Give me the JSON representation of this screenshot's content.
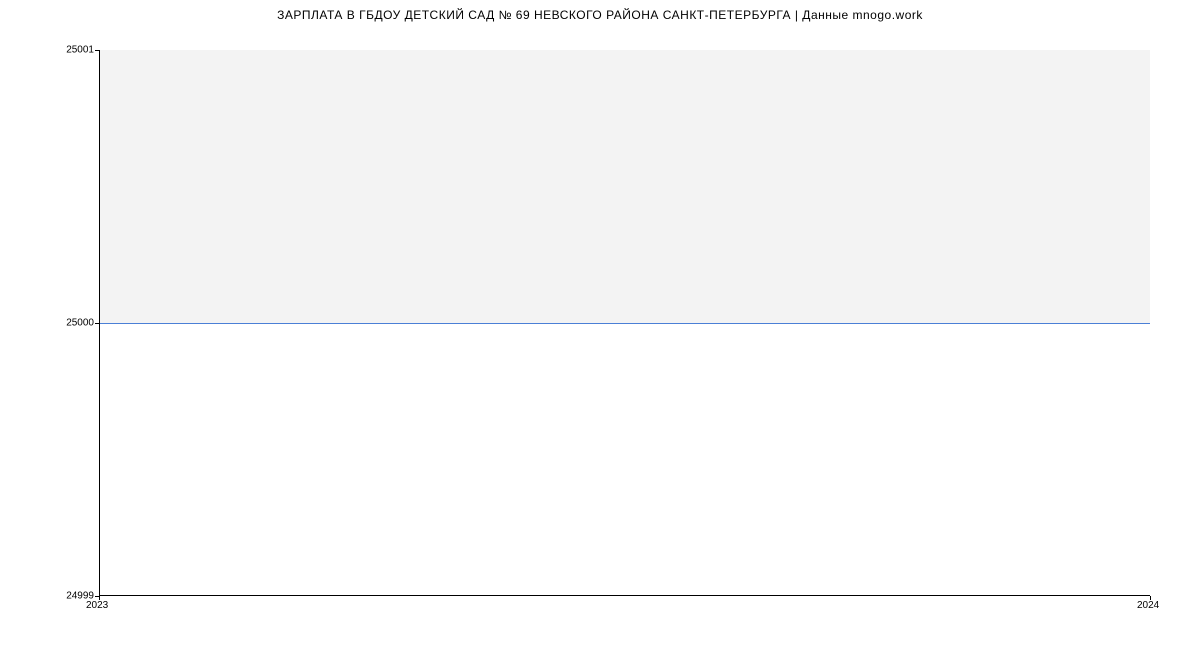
{
  "chart_data": {
    "type": "line",
    "title": "ЗАРПЛАТА В ГБДОУ ДЕТСКИЙ САД № 69 НЕВСКОГО РАЙОНА САНКТ-ПЕТЕРБУРГА | Данные mnogo.work",
    "x": [
      2023,
      2024
    ],
    "values": [
      25000,
      25000
    ],
    "ylim": [
      24999,
      25001
    ],
    "xlim": [
      2023,
      2024
    ],
    "y_ticks": [
      24999,
      25000,
      25001
    ],
    "x_ticks": [
      2023,
      2024
    ],
    "xlabel": "",
    "ylabel": "",
    "line_color": "#4a7fd6",
    "fill_above_line": "#f3f3f3"
  },
  "labels": {
    "y_tick_0": "24999",
    "y_tick_1": "25000",
    "y_tick_2": "25001",
    "x_tick_0": "2023",
    "x_tick_1": "2024"
  }
}
